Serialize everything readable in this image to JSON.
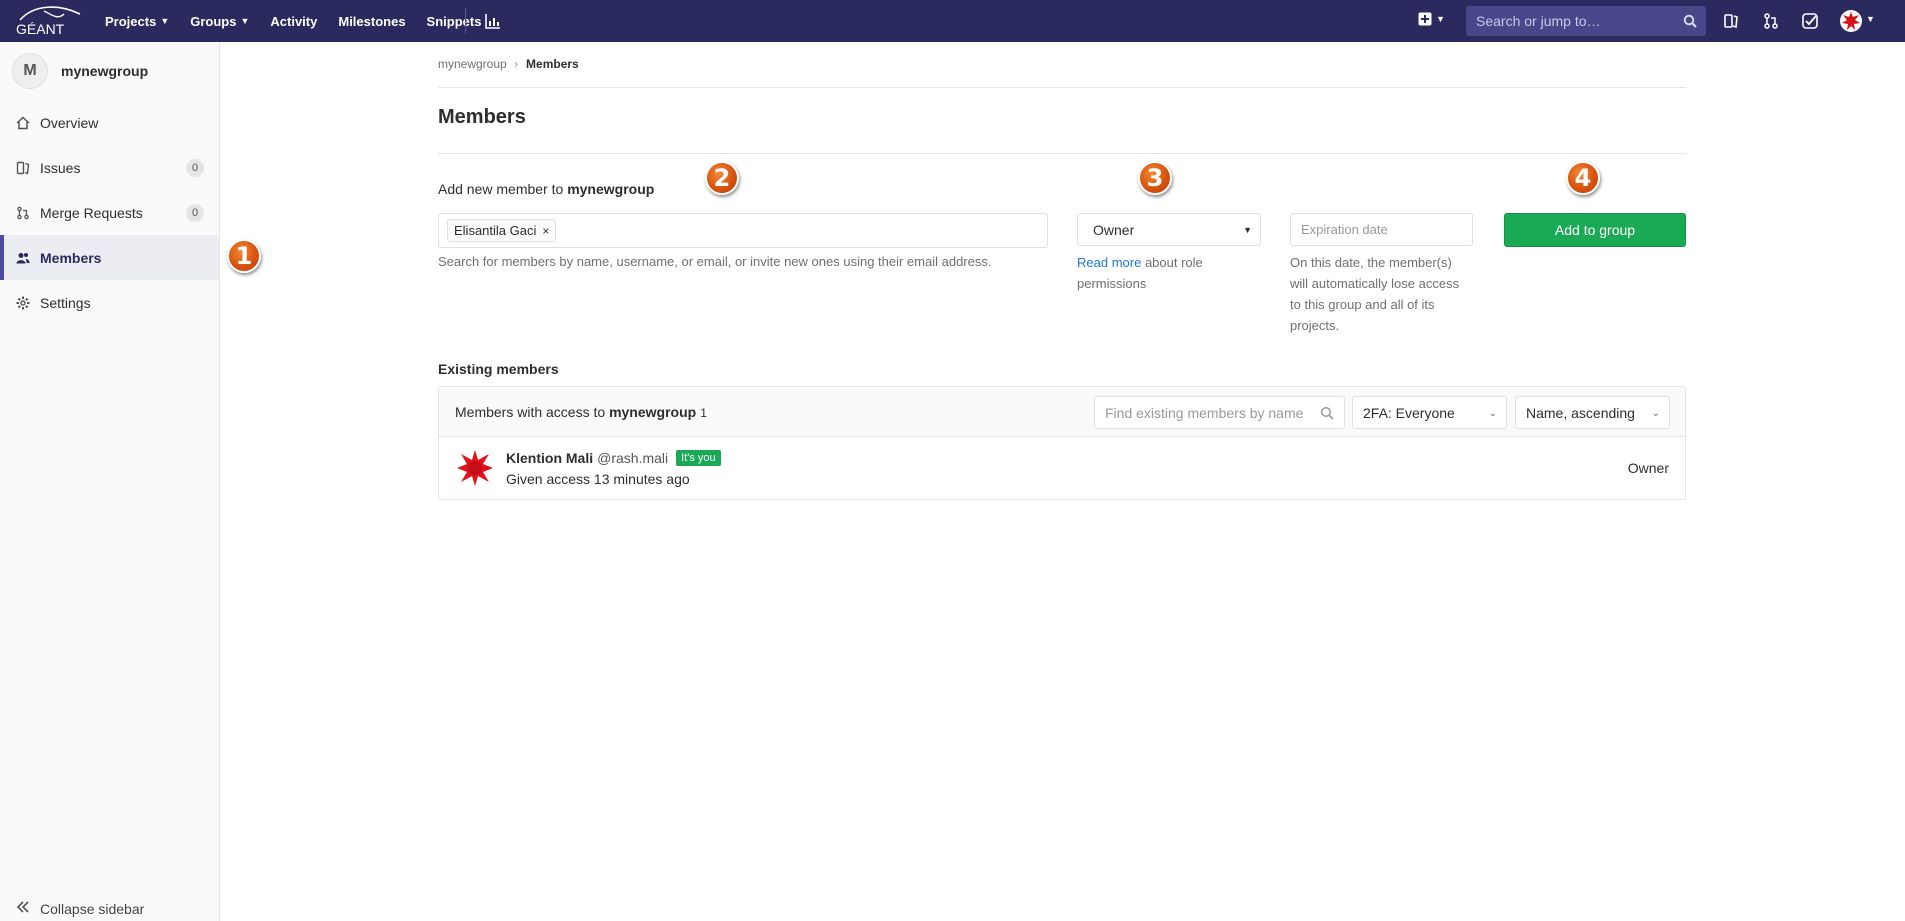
{
  "navbar": {
    "logo_text": "GÉANT",
    "links": [
      {
        "label": "Projects",
        "dropdown": true
      },
      {
        "label": "Groups",
        "dropdown": true
      },
      {
        "label": "Activity",
        "dropdown": false
      },
      {
        "label": "Milestones",
        "dropdown": false
      },
      {
        "label": "Snippets",
        "dropdown": false
      }
    ],
    "search_placeholder": "Search or jump to…",
    "background_color": "#2b2a5f"
  },
  "sidebar": {
    "group_initial": "M",
    "group_name": "mynewgroup",
    "items": [
      {
        "label": "Overview",
        "icon": "home-icon"
      },
      {
        "label": "Issues",
        "icon": "issues-icon",
        "count": "0"
      },
      {
        "label": "Merge Requests",
        "icon": "merge-request-icon",
        "count": "0"
      },
      {
        "label": "Members",
        "icon": "users-icon",
        "active": true
      },
      {
        "label": "Settings",
        "icon": "settings-icon"
      }
    ],
    "collapse_label": "Collapse sidebar"
  },
  "breadcrumb": {
    "parent": "mynewgroup",
    "current": "Members"
  },
  "page_title": "Members",
  "add_member": {
    "label_prefix": "Add new member to",
    "group_name": "mynewgroup",
    "selected_token": "Elisantila Gaci",
    "search_help": "Search for members by name, username, or email, or invite new ones using their email address.",
    "role_value": "Owner",
    "read_more_link": "Read more",
    "role_help_suffix": "about role permissions",
    "expiration_placeholder": "Expiration date",
    "expiration_help": "On this date, the member(s) will automatically lose access to this group and all of its projects.",
    "add_button": "Add to group"
  },
  "annotations": [
    "1",
    "2",
    "3",
    "4"
  ],
  "existing": {
    "title": "Existing members",
    "header_prefix": "Members with access to",
    "group_name": "mynewgroup",
    "count": "1",
    "find_placeholder": "Find existing members by name",
    "twofa_filter": "2FA: Everyone",
    "sort": "Name, ascending",
    "members": [
      {
        "name": "Klention Mali",
        "handle": "@rash.mali",
        "badge": "It's you",
        "since": "Given access 13 minutes ago",
        "role": "Owner"
      }
    ]
  },
  "colors": {
    "accent_green": "#1aaa55",
    "link_blue": "#1f78d1",
    "annotation_orange": "#d9520c"
  }
}
